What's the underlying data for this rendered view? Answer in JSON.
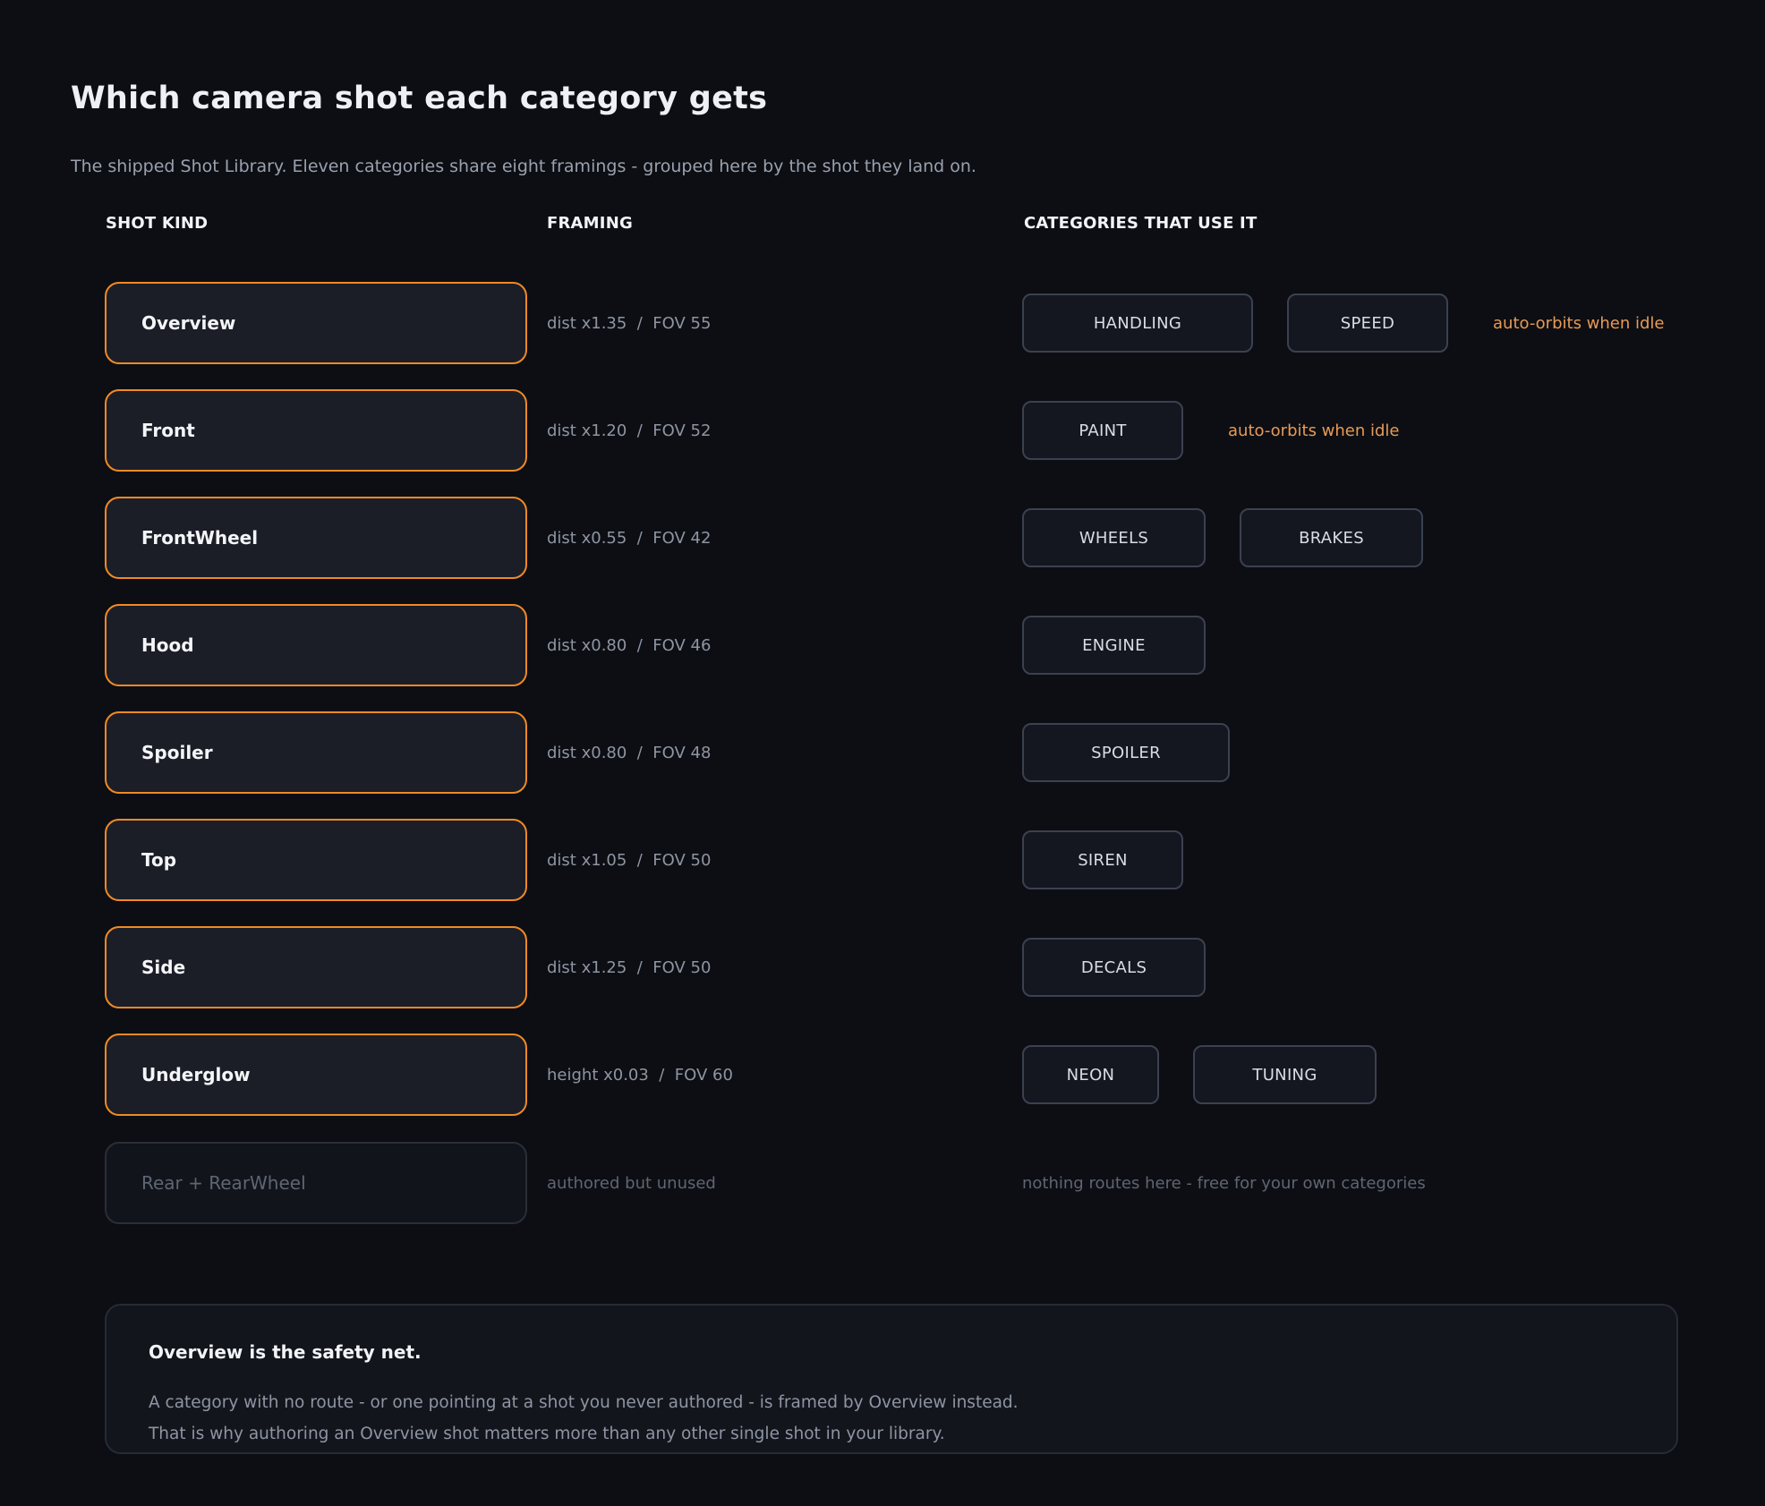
{
  "header": {
    "title": "Which camera shot each category gets",
    "subtitle": "The shipped Shot Library. Eleven categories share eight framings - grouped here by the shot they land on."
  },
  "columns": {
    "shot_kind": "SHOT KIND",
    "framing": "FRAMING",
    "categories": "CATEGORIES THAT USE IT"
  },
  "rows": [
    {
      "shot": "Overview",
      "framing": "dist x1.35  /  FOV 55",
      "cats": [
        "HANDLING",
        "SPEED"
      ],
      "note": "auto-orbits when idle"
    },
    {
      "shot": "Front",
      "framing": "dist x1.20  /  FOV 52",
      "cats": [
        "PAINT"
      ],
      "note": "auto-orbits when idle"
    },
    {
      "shot": "FrontWheel",
      "framing": "dist x0.55  /  FOV 42",
      "cats": [
        "WHEELS",
        "BRAKES"
      ]
    },
    {
      "shot": "Hood",
      "framing": "dist x0.80  /  FOV 46",
      "cats": [
        "ENGINE"
      ]
    },
    {
      "shot": "Spoiler",
      "framing": "dist x0.80  /  FOV 48",
      "cats": [
        "SPOILER"
      ]
    },
    {
      "shot": "Top",
      "framing": "dist x1.05  /  FOV 50",
      "cats": [
        "SIREN"
      ]
    },
    {
      "shot": "Side",
      "framing": "dist x1.25  /  FOV 50",
      "cats": [
        "DECALS"
      ]
    },
    {
      "shot": "Underglow",
      "framing": "height x0.03  /  FOV 60",
      "cats": [
        "NEON",
        "TUNING"
      ]
    },
    {
      "shot": "Rear  +  RearWheel",
      "framing": "authored but unused",
      "nothing": "nothing routes here - free for your own categories",
      "unused": true
    }
  ],
  "callout": {
    "title": "Overview is the safety net.",
    "line1": "A category with no route - or one pointing at a shot you never authored - is framed by Overview instead.",
    "line2": "That is why authoring an Overview shot matters more than any other single shot in your library."
  },
  "colors": {
    "accent": "#f08a24",
    "note": "#e89a55",
    "background": "#0c0e13"
  }
}
